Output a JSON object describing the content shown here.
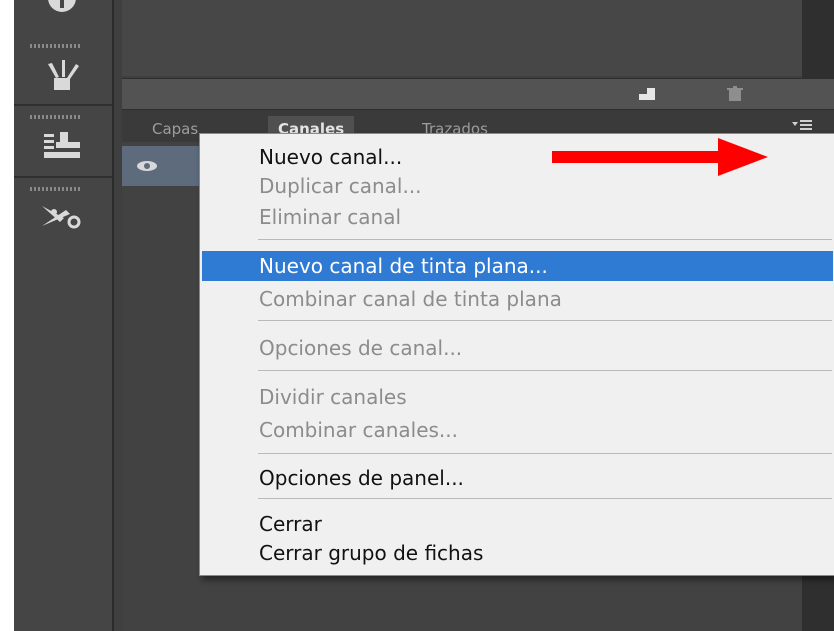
{
  "tabs": [
    {
      "label": "Capas",
      "active": false
    },
    {
      "label": "Canales",
      "active": true
    },
    {
      "label": "Trazados",
      "active": false
    }
  ],
  "context_menu": {
    "items": [
      {
        "label": "Nuevo canal...",
        "enabled": true,
        "highlighted": false
      },
      {
        "label": "Duplicar canal...",
        "enabled": false,
        "highlighted": false
      },
      {
        "label": "Eliminar canal",
        "enabled": false,
        "highlighted": false
      },
      {
        "label": "Nuevo canal de tinta plana...",
        "enabled": true,
        "highlighted": true
      },
      {
        "label": "Combinar canal de tinta plana",
        "enabled": false,
        "highlighted": false
      },
      {
        "label": "Opciones de canal...",
        "enabled": false,
        "highlighted": false
      },
      {
        "label": "Dividir canales",
        "enabled": false,
        "highlighted": false
      },
      {
        "label": "Combinar canales...",
        "enabled": false,
        "highlighted": false
      },
      {
        "label": "Opciones de panel...",
        "enabled": true,
        "highlighted": false
      },
      {
        "label": "Cerrar",
        "enabled": true,
        "highlighted": false
      },
      {
        "label": "Cerrar grupo de fichas",
        "enabled": true,
        "highlighted": false
      }
    ]
  },
  "icons": {
    "tool_1": "info-icon",
    "tool_2": "brush-preset-icon",
    "tool_3": "clone-source-icon",
    "tool_4": "tools-icon",
    "footer_new": "new-channel-icon",
    "footer_delete": "trash-icon",
    "panel_menu": "panel-menu-icon",
    "visibility": "eye-icon",
    "annotation": "red-arrow-icon"
  },
  "colors": {
    "highlight": "#2f7ad3",
    "arrow": "#ff0000",
    "selected_row": "#5d6b7d"
  }
}
